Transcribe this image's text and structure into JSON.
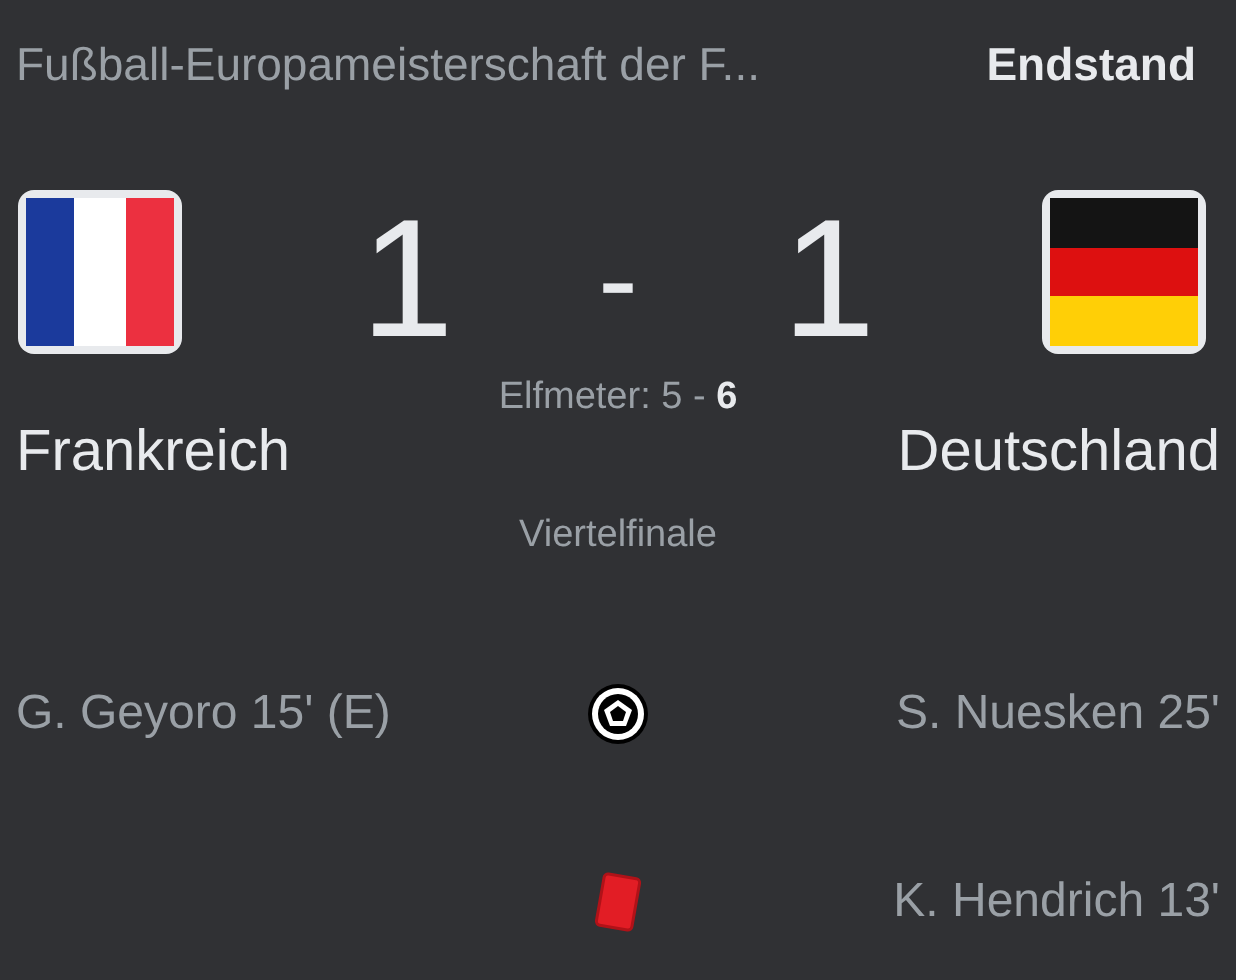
{
  "header": {
    "competition": "Fußball-Europameisterschaft der F...",
    "status": "Endstand"
  },
  "home": {
    "name": "Frankreich",
    "score": "1",
    "kind": "vertical"
  },
  "away": {
    "name": "Deutschland",
    "score": "1",
    "kind": "horizontal"
  },
  "separator": "-",
  "penalties": "Elfmeter: 5 - **6**",
  "round": "Viertelfinale",
  "events": [
    {
      "kind": "goal",
      "home": "G. Geyoro 15' (E)",
      "away": "S. Nuesken 25'"
    },
    {
      "kind": "red_card",
      "away": "K. Hendrich 13'"
    }
  ]
}
